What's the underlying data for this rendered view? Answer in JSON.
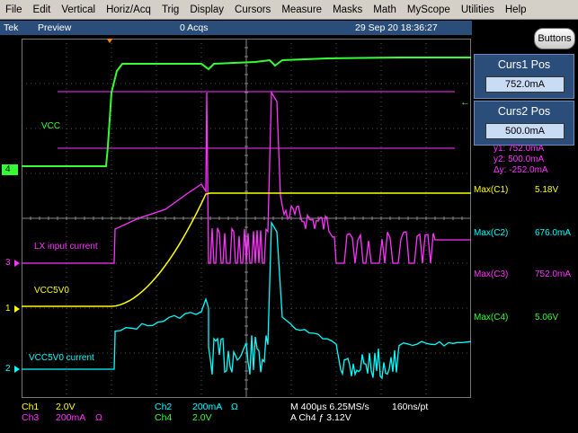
{
  "menu": [
    "File",
    "Edit",
    "Vertical",
    "Horiz/Acq",
    "Trig",
    "Display",
    "Cursors",
    "Measure",
    "Masks",
    "Math",
    "MyScope",
    "Utilities",
    "Help"
  ],
  "status": {
    "brand": "Tek",
    "mode": "Preview",
    "acqs": "0 Acqs",
    "datetime": "29 Sep 20 18:36:27"
  },
  "buttons_label": "Buttons",
  "cursors": {
    "curs1_title": "Curs1 Pos",
    "curs1_value": "752.0mA",
    "curs2_title": "Curs2 Pos",
    "curs2_value": "500.0mA",
    "y1": "y1:   752.0mA",
    "y2": "y2:   500.0mA",
    "dy": "Δy: -252.0mA"
  },
  "measurements": [
    {
      "label": "Max(C1)",
      "value": "5.18V",
      "color": "#ffff00"
    },
    {
      "label": "Max(C2)",
      "value": "676.0mA",
      "color": "#00ffff"
    },
    {
      "label": "Max(C3)",
      "value": "752.0mA",
      "color": "#ff33ff"
    },
    {
      "label": "Max(C4)",
      "value": "5.06V",
      "color": "#33ff33"
    }
  ],
  "trace_labels": {
    "vcc": "VCC",
    "lx": "LX input current",
    "vcc5v0": "VCC5V0",
    "vcc5v0_current": "VCC5V0 current"
  },
  "channel_markers": {
    "c4": "4",
    "c3": "3",
    "c1": "1",
    "c2": "2"
  },
  "bottom": {
    "ch1_name": "Ch1",
    "ch1_scale": "2.0V",
    "ch2_name": "Ch2",
    "ch2_scale": "200mA",
    "ch2_unit": "Ω",
    "ch3_name": "Ch3",
    "ch3_scale": "200mA",
    "ch3_unit": "Ω",
    "ch4_name": "Ch4",
    "ch4_scale": "2.0V",
    "timebase": "M 400μs 6.25MS/s",
    "pt": "160ns/pt",
    "trigger": "A  Ch4  ƒ  3.12V"
  },
  "colors": {
    "ch1": "#ffff00",
    "ch2": "#00ffff",
    "ch3": "#ff33ff",
    "ch4": "#33ff33",
    "panel": "#2b4d7a"
  }
}
